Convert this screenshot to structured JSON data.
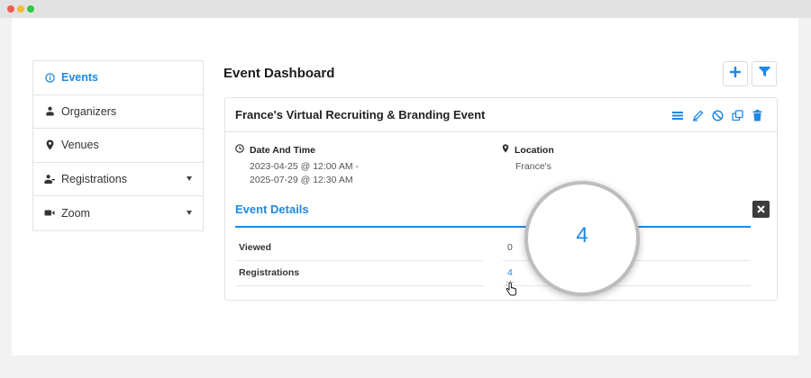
{
  "sidebar": {
    "items": [
      {
        "label": "Events",
        "icon": "info-circle-icon",
        "active": true
      },
      {
        "label": "Organizers",
        "icon": "person-icon"
      },
      {
        "label": "Venues",
        "icon": "map-pin-icon"
      },
      {
        "label": "Registrations",
        "icon": "registrations-icon",
        "has_caret": true
      },
      {
        "label": "Zoom",
        "icon": "video-camera-icon",
        "has_caret": true
      }
    ]
  },
  "header": {
    "title": "Event Dashboard",
    "add_icon": "plus-icon",
    "filter_icon": "filter-icon"
  },
  "event": {
    "title": "France's Virtual Recruiting & Branding Event",
    "actions": [
      "list-icon",
      "edit-icon",
      "cancel-icon",
      "duplicate-icon",
      "trash-icon"
    ],
    "date_label": "Date And Time",
    "date_line1": "2023-04-25 @ 12:00 AM -",
    "date_line2": "2025-07-29 @ 12:30 AM",
    "location_label": "Location",
    "location_value": "France's"
  },
  "details": {
    "title": "Event Details",
    "rows": [
      {
        "label": "Viewed",
        "value": "0"
      },
      {
        "label": "Registrations",
        "value": "4"
      }
    ],
    "magnified_value": "4"
  },
  "colors": {
    "accent": "#1e88e5",
    "close_button": "#3c3c3c"
  }
}
